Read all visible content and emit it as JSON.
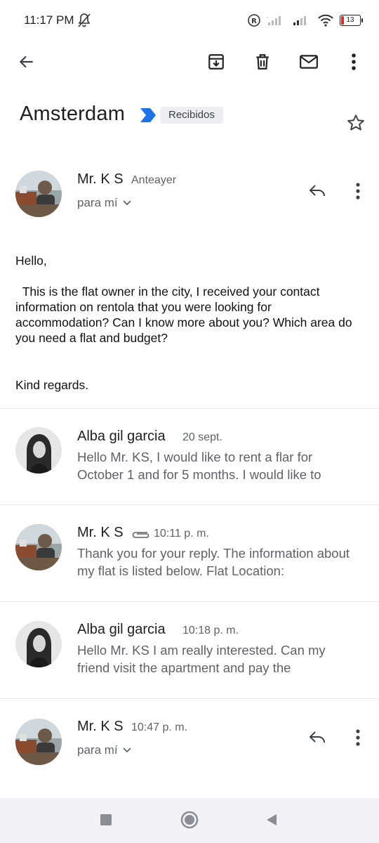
{
  "status_bar": {
    "time": "11:17 PM",
    "battery": "13"
  },
  "toolbar": {
    "icons": [
      "back-arrow-icon",
      "archive-icon",
      "trash-icon",
      "mail-icon",
      "more-vert-icon"
    ]
  },
  "subject": {
    "title": "Amsterdam",
    "label": "Recibidos"
  },
  "colors": {
    "accent": "#1a73e8",
    "chip_bg": "#eceef1",
    "nav_bg": "#f0f2f8"
  },
  "thread": [
    {
      "sender": "Mr. K S",
      "time": "Anteayer",
      "recipient": "para mí"
    },
    {
      "sender": "Alba gil garcia",
      "time": "20 sept.",
      "snippet": "Hello Mr. KS, I would like to rent a flar for October 1 and for 5 months. I would like to"
    },
    {
      "sender": "Mr. K S",
      "time": "10:11 p. m.",
      "snippet": "Thank you for your reply. The information about my flat is listed below. Flat Location:"
    },
    {
      "sender": "Alba gil garcia",
      "time": "10:18 p. m.",
      "snippet": "Hello Mr. KS I am really interested. Can my friend visit the apartment and pay the"
    },
    {
      "sender": "Mr. K S",
      "time": "10:47 p. m.",
      "recipient": "para mí"
    }
  ],
  "message_body": {
    "greeting": "Hello,",
    "paragraph": "  This is the flat owner in the city, I received your contact information on rentola that you were looking for accommodation? Can I know more about you? Which area do you need a flat and budget?",
    "closing": "Kind regards."
  }
}
